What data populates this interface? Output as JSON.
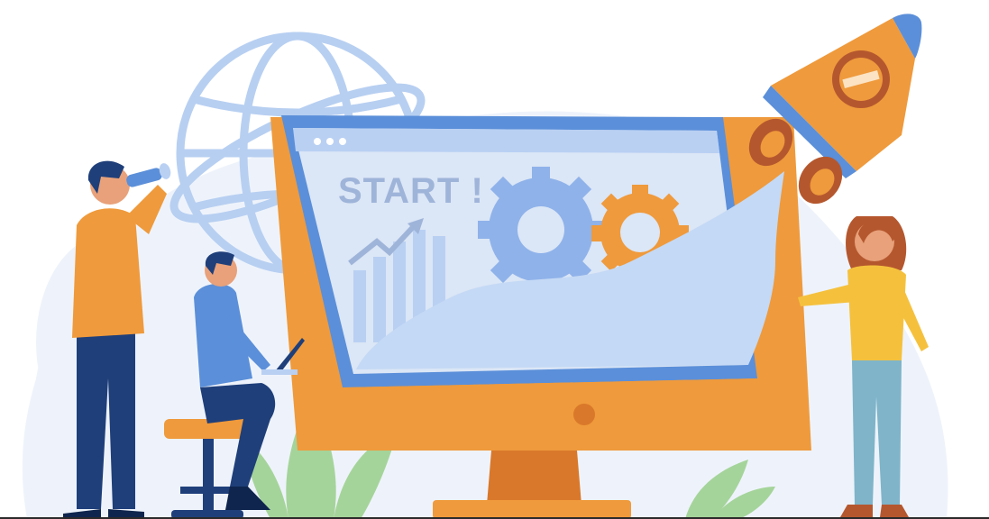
{
  "illustration": {
    "screen_text": "START !"
  },
  "colors": {
    "orange": "#ef9a3c",
    "dark_orange": "#d9782a",
    "blue": "#5b8fd9",
    "light_blue": "#b9d0f3",
    "pale_blue": "#dbe6f6",
    "navy": "#1f3f7a",
    "green": "#a5d49a",
    "red_brown": "#b5572e",
    "yellow": "#f5c13d",
    "teal": "#7fb4c9"
  }
}
